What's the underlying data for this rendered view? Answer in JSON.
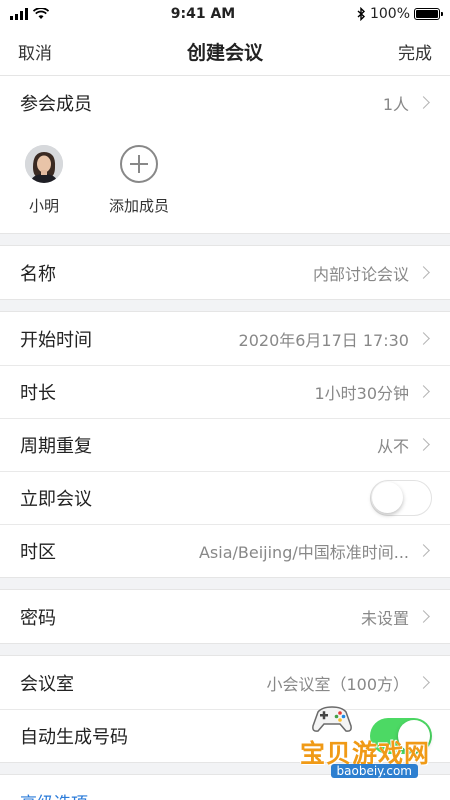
{
  "status_bar": {
    "time": "9:41 AM",
    "battery_text": "100%"
  },
  "nav": {
    "cancel_label": "取消",
    "title": "创建会议",
    "done_label": "完成"
  },
  "participants": {
    "label": "参会成员",
    "count": "1人",
    "members": [
      {
        "name": "小明"
      }
    ],
    "add_label": "添加成员"
  },
  "fields": {
    "name": {
      "label": "名称",
      "value": "内部讨论会议"
    },
    "start_time": {
      "label": "开始时间",
      "value": "2020年6月17日 17:30"
    },
    "duration": {
      "label": "时长",
      "value": "1小时30分钟"
    },
    "repeat": {
      "label": "周期重复",
      "value": "从不"
    },
    "instant": {
      "label": "立即会议",
      "toggle": false
    },
    "timezone": {
      "label": "时区",
      "value": "Asia/Beijing/中国标准时间..."
    },
    "password": {
      "label": "密码",
      "value": "未设置"
    },
    "room": {
      "label": "会议室",
      "value": "小会议室（100方）"
    },
    "auto_number": {
      "label": "自动生成号码",
      "toggle": true
    }
  },
  "advanced_label": "高级选项",
  "watermark": {
    "title": "宝贝游戏网",
    "url": "baobeiy.com"
  },
  "colors": {
    "toggle_on": "#4cd964",
    "link": "#2b7bd9",
    "watermark_orange": "#f09a16"
  }
}
